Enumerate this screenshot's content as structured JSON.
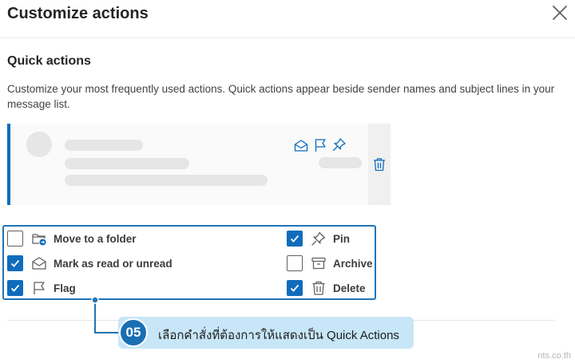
{
  "dialog": {
    "title": "Customize actions",
    "close_icon": "close-icon"
  },
  "quick_actions": {
    "heading": "Quick actions",
    "description": "Customize your most frequently used actions. Quick actions appear beside sender names and subject lines in your message list."
  },
  "preview": {
    "accent_color": "#0f6cbd",
    "hover_icons": [
      "envelope-open-icon",
      "flag-icon",
      "pin-icon"
    ],
    "side_icon": "trash-icon"
  },
  "options": [
    {
      "label": "Move to a folder",
      "checked": false,
      "icon": "folder-move-icon"
    },
    {
      "label": "Mark as read or unread",
      "checked": true,
      "icon": "envelope-open-icon"
    },
    {
      "label": "Flag",
      "checked": true,
      "icon": "flag-icon"
    },
    {
      "label": "Pin",
      "checked": true,
      "icon": "pin-icon"
    },
    {
      "label": "Archive",
      "checked": false,
      "icon": "archive-icon"
    },
    {
      "label": "Delete",
      "checked": true,
      "icon": "trash-icon"
    }
  ],
  "annotation": {
    "step": "05",
    "text": "เลือกคำสั่งที่ต้องการให้แสดงเป็น Quick Actions",
    "highlight_color": "#1f74b6",
    "badge_color": "#1a6fb3",
    "bubble_color": "#c7e6f7"
  },
  "watermark": "nts.co.th"
}
